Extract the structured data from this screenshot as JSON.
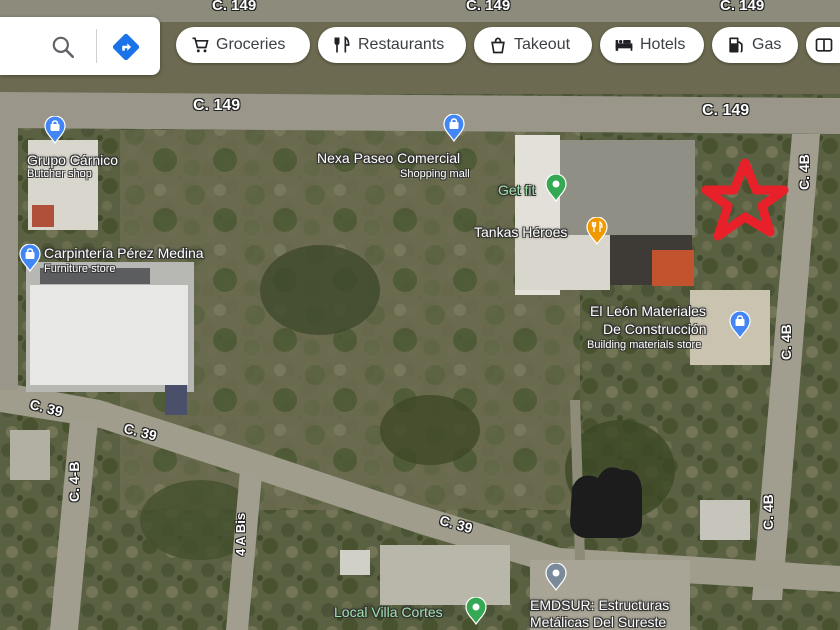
{
  "search": {
    "search_icon": "search-icon",
    "directions_icon": "directions-icon",
    "accent": "#1a73e8"
  },
  "chips": [
    {
      "label": "Groceries",
      "icon": "cart-icon"
    },
    {
      "label": "Restaurants",
      "icon": "fork-knife-icon"
    },
    {
      "label": "Takeout",
      "icon": "takeout-bag-icon"
    },
    {
      "label": "Hotels",
      "icon": "bed-icon"
    },
    {
      "label": "Gas",
      "icon": "gas-pump-icon"
    },
    {
      "label": "",
      "icon": "more-icon"
    }
  ],
  "roads": {
    "c149_top_1": "C. 149",
    "c149_top_2": "C. 149",
    "c149_top_3": "C. 149",
    "c149_left": "C. 149",
    "c149_right": "C. 149",
    "c39_left": "C. 39",
    "c39_mid": "C. 39",
    "c39_right": "C. 39",
    "c4b_left": "C. 4-B",
    "c4a_bis": "4 A Bis",
    "c4b_top": "C. 4B",
    "c4b_mid": "C. 4B",
    "c4b_bottom": "C. 4B"
  },
  "places": {
    "grupo_carnico": {
      "name": "Grupo Cárnico",
      "category": "Butcher shop"
    },
    "carpinteria": {
      "name": "Carpintería Pérez Medina",
      "category": "Furniture store"
    },
    "nexa": {
      "name": "Nexa Paseo Comercial",
      "category": "Shopping mall"
    },
    "getfit": {
      "name": "Get fit"
    },
    "tankas": {
      "name": "Tankas Héroes"
    },
    "el_leon": {
      "name_line1": "El León Materiales",
      "name_line2": "De Construcción",
      "category": "Building materials store"
    },
    "local_villa": {
      "name": "Local Villa Cortes"
    },
    "emdsur": {
      "name_line1": "EMDSUR: Estructuras",
      "name_line2": "Metálicas Del Sureste"
    }
  },
  "colors": {
    "shopping_pin": "#4285f4",
    "food_pin": "#f29900",
    "fitness_pin": "#34a853",
    "generic_pin": "#7a8a9a",
    "marker": "#e8202a"
  }
}
